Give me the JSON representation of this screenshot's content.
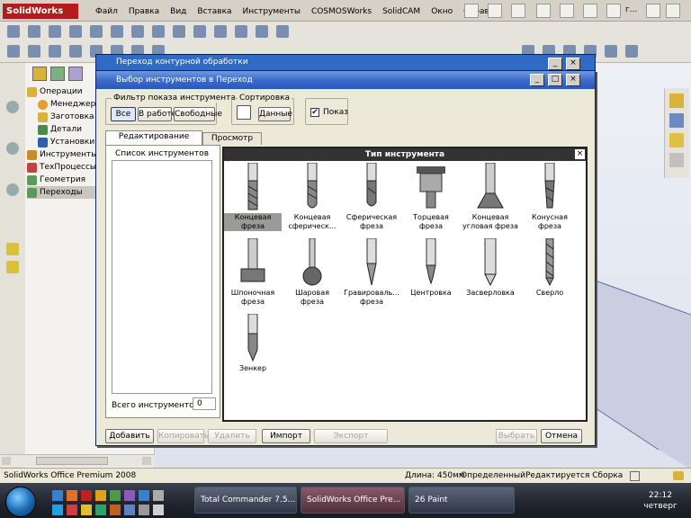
{
  "app": {
    "name": "SolidWorks"
  },
  "menu": [
    "Файл",
    "Правка",
    "Вид",
    "Вставка",
    "Инструменты",
    "COSMOSWorks",
    "SolidCAM",
    "Окно",
    "Справка"
  ],
  "right_title": "г...",
  "tree": {
    "items": [
      "Операции",
      "Менеджер",
      "Заготовка",
      "Детали",
      "Установки",
      "Инструменты",
      "ТехПроцессы",
      "Геометрия",
      "Переходы"
    ]
  },
  "dialog_back": {
    "title": "Переход контурной обработки"
  },
  "dialog": {
    "title": "Выбор инструментов в Переход",
    "filter": {
      "label": "Фильтр показа инструмента",
      "buttons": [
        "Все",
        "В работе",
        "Свободные"
      ]
    },
    "sort": {
      "label": "Сортировка",
      "button": "Данные"
    },
    "show": {
      "label": "Показ",
      "checked": true
    },
    "tabs": [
      "Редактирование",
      "Просмотр"
    ],
    "list_header": "Список инструментов",
    "total_label": "Всего инструментов:",
    "total_value": "0",
    "tool_panel_title": "Тип инструмента",
    "tools": [
      {
        "label": "Концевая фреза",
        "selected": true,
        "icon": "end-mill"
      },
      {
        "label": "Концевая сферическ...",
        "selected": false,
        "icon": "ball-end-mill"
      },
      {
        "label": "Сферическая фреза",
        "selected": false,
        "icon": "spherical-mill"
      },
      {
        "label": "Торцевая фреза",
        "selected": false,
        "icon": "face-mill"
      },
      {
        "label": "Концевая угловая фреза",
        "selected": false,
        "icon": "dovetail-mill"
      },
      {
        "label": "Конусная фреза",
        "selected": false,
        "icon": "taper-mill"
      },
      {
        "label": "Шпоночная фреза",
        "selected": false,
        "icon": "keyway-cutter"
      },
      {
        "label": "Шаровая фреза",
        "selected": false,
        "icon": "lollipop-mill"
      },
      {
        "label": "Гравироваль... фреза",
        "selected": false,
        "icon": "engraving-mill"
      },
      {
        "label": "Центровка",
        "selected": false,
        "icon": "center-drill"
      },
      {
        "label": "Засверловка",
        "selected": false,
        "icon": "spot-drill"
      },
      {
        "label": "Сверло",
        "selected": false,
        "icon": "drill"
      },
      {
        "label": "Зенкер",
        "selected": false,
        "icon": "countersink"
      }
    ],
    "buttons": {
      "add": "Добавить",
      "copy": "Копировать",
      "delete": "Удалить",
      "import": "Импорт",
      "export": "Экспорт",
      "select": "Выбрать",
      "cancel": "Отмена"
    }
  },
  "status": {
    "product": "SolidWorks Office Premium 2008",
    "length": "Длина: 450мм",
    "state": "Определенный",
    "editing": "Редактируется Сборка"
  },
  "taskbar": {
    "items": [
      "Total Commander 7.5...",
      "SolidWorks Office Pre...",
      "26 Paint"
    ],
    "time": "22:12",
    "day": "четверг"
  }
}
